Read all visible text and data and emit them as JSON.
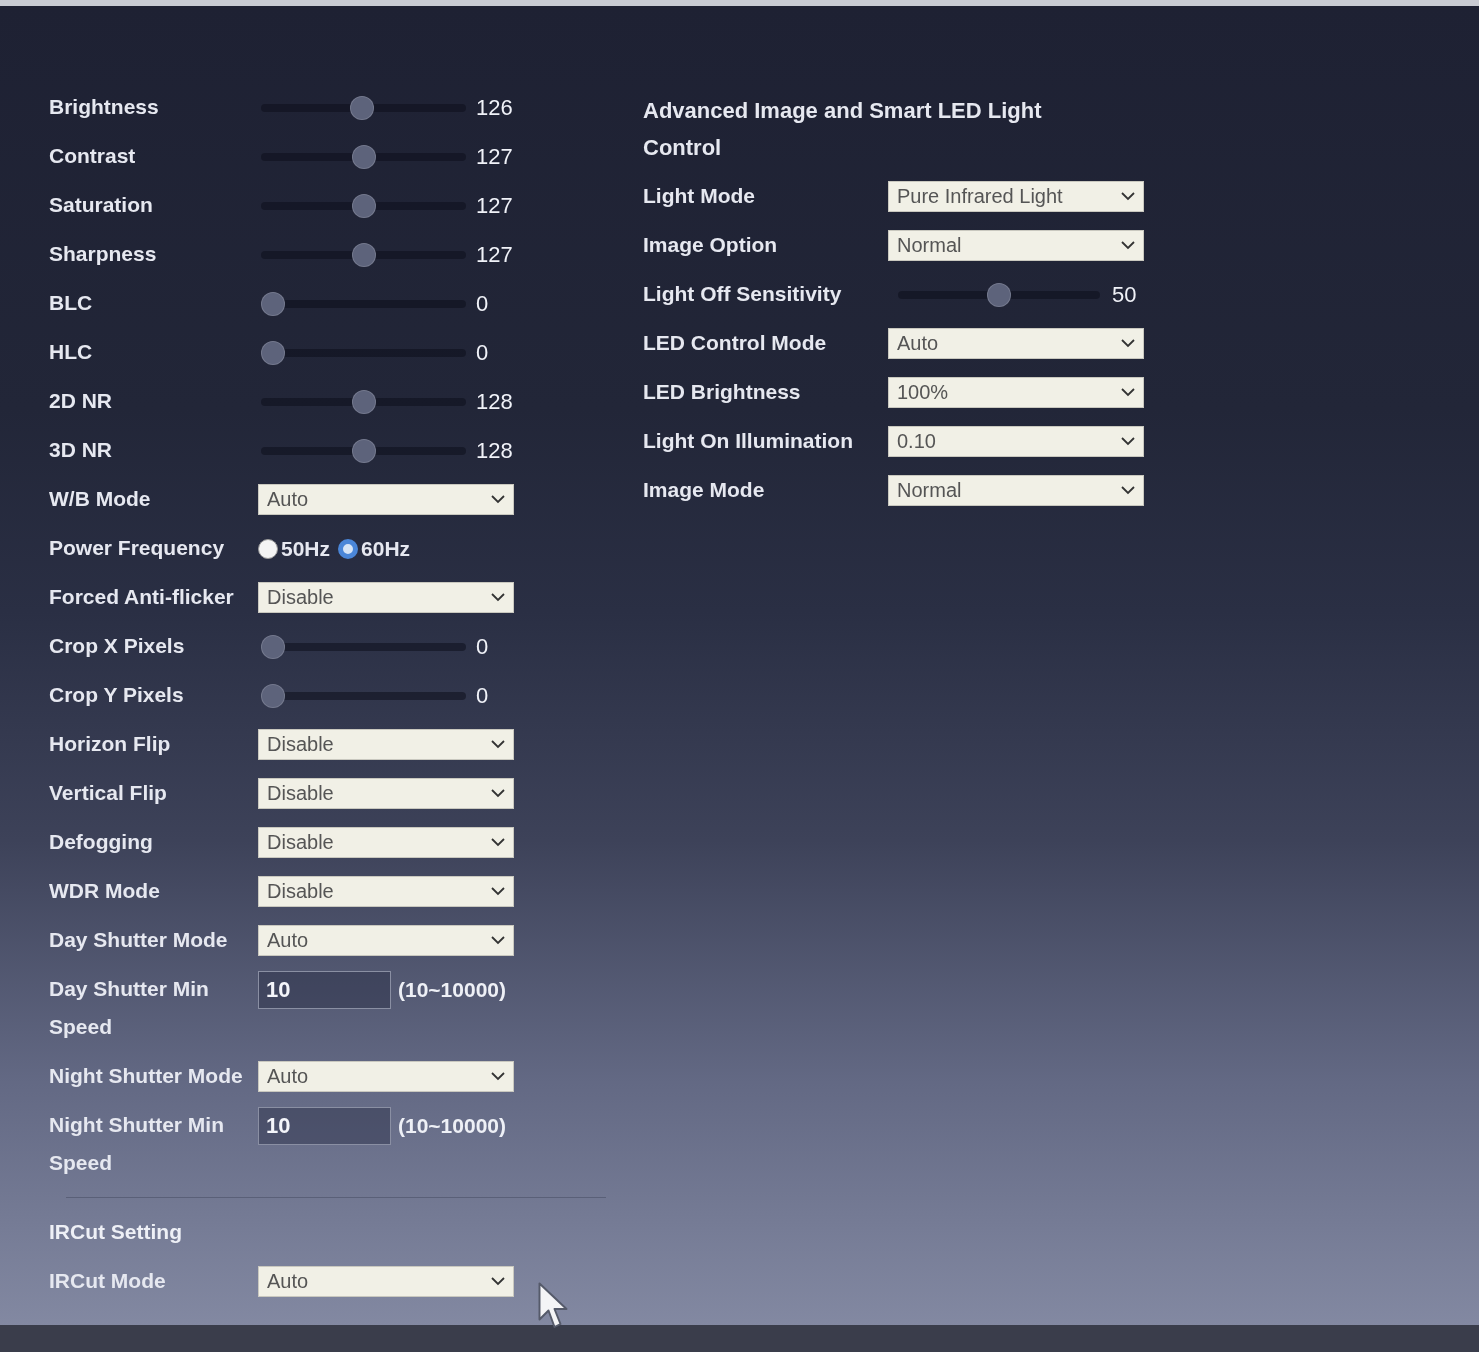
{
  "image_settings": {
    "rows": [
      {
        "kind": "slider",
        "label": "Brightness",
        "level": 0.49,
        "reading": "126"
      },
      {
        "kind": "slider",
        "label": "Contrast",
        "level": 0.5,
        "reading": "127"
      },
      {
        "kind": "slider",
        "label": "Saturation",
        "level": 0.5,
        "reading": "127"
      },
      {
        "kind": "slider",
        "label": "Sharpness",
        "level": 0.5,
        "reading": "127"
      },
      {
        "kind": "slider",
        "label": "BLC",
        "level": 0,
        "reading": "0"
      },
      {
        "kind": "slider",
        "label": "HLC",
        "level": 0,
        "reading": "0"
      },
      {
        "kind": "slider",
        "label": "2D NR",
        "level": 0.5,
        "reading": "128"
      },
      {
        "kind": "slider",
        "label": "3D NR",
        "level": 0.5,
        "reading": "128"
      },
      {
        "kind": "select",
        "label": "W/B Mode",
        "value": "Auto"
      },
      {
        "kind": "radio",
        "label": "Power Frequency",
        "options": [
          {
            "label": "50Hz",
            "selected": false
          },
          {
            "label": "60Hz",
            "selected": true
          }
        ]
      },
      {
        "kind": "select",
        "label": "Forced Anti-flicker",
        "value": "Disable"
      },
      {
        "kind": "slider",
        "label": "Crop X Pixels",
        "level": 0,
        "reading": "0"
      },
      {
        "kind": "slider",
        "label": "Crop Y Pixels",
        "level": 0,
        "reading": "0"
      },
      {
        "kind": "select",
        "label": "Horizon Flip",
        "value": "Disable"
      },
      {
        "kind": "select",
        "label": "Vertical Flip",
        "value": "Disable"
      },
      {
        "kind": "select",
        "label": "Defogging",
        "value": "Disable"
      },
      {
        "kind": "select",
        "label": "WDR Mode",
        "value": "Disable"
      },
      {
        "kind": "select",
        "label": "Day Shutter Mode",
        "value": "Auto"
      },
      {
        "kind": "number",
        "label": "Day Shutter Min Speed",
        "value": "10",
        "hint": "(10~10000)"
      },
      {
        "kind": "select",
        "label": "Night Shutter Mode",
        "value": "Auto"
      },
      {
        "kind": "number",
        "label": "Night Shutter Min Speed",
        "value": "10",
        "hint": "(10~10000)"
      }
    ]
  },
  "ircut": {
    "title": "IRCut Setting",
    "rows": [
      {
        "kind": "select",
        "label": "IRCut Mode",
        "value": "Auto"
      }
    ]
  },
  "advanced": {
    "title": "Advanced Image and Smart LED Light Control",
    "rows": [
      {
        "kind": "select",
        "label": "Light Mode",
        "value": "Pure Infrared Light"
      },
      {
        "kind": "select",
        "label": "Image Option",
        "value": "Normal"
      },
      {
        "kind": "slider",
        "label": "Light Off Sensitivity",
        "level": 0.5,
        "reading": "50"
      },
      {
        "kind": "select",
        "label": "LED Control Mode",
        "value": "Auto"
      },
      {
        "kind": "select",
        "label": "LED Brightness",
        "value": "100%"
      },
      {
        "kind": "select",
        "label": "Light On Illumination",
        "value": "0.10"
      },
      {
        "kind": "select",
        "label": "Image Mode",
        "value": "Normal"
      }
    ]
  }
}
